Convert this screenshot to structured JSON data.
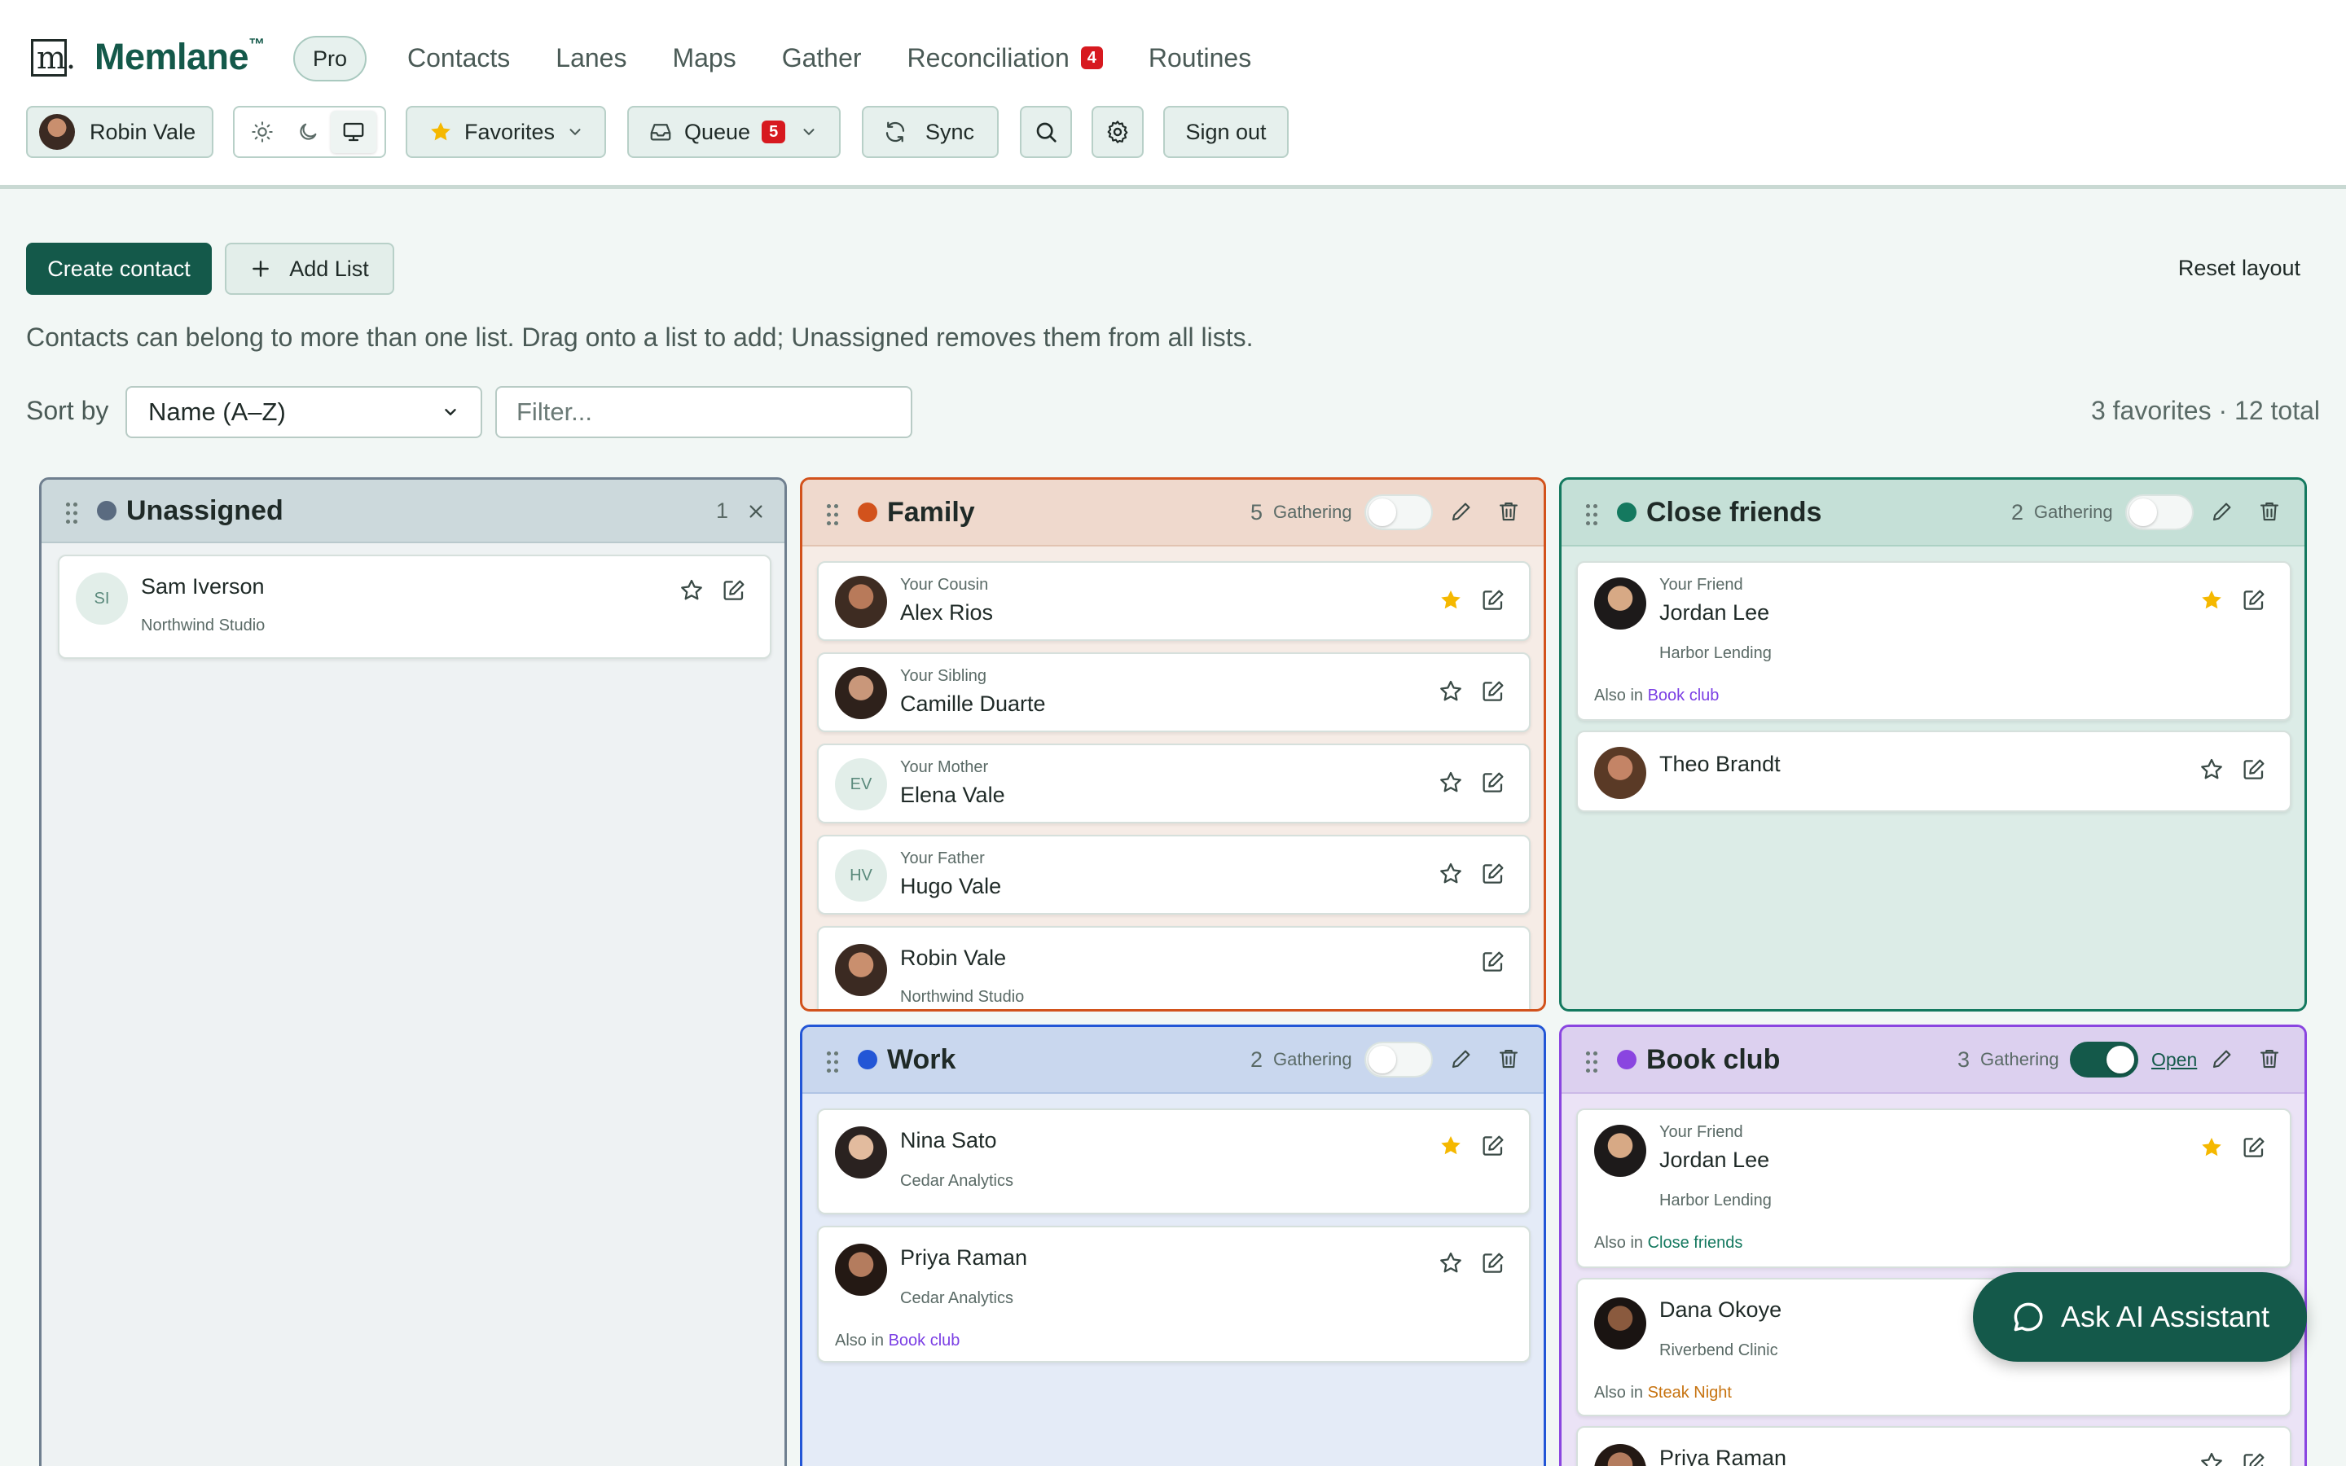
{
  "brand": {
    "logo_glyph": "m.",
    "name": "Memlane",
    "tm": "™",
    "plan_badge": "Pro"
  },
  "nav": [
    {
      "label": "Contacts"
    },
    {
      "label": "Lanes"
    },
    {
      "label": "Maps"
    },
    {
      "label": "Gather"
    },
    {
      "label": "Reconciliation",
      "badge": "4"
    },
    {
      "label": "Routines"
    }
  ],
  "toolbar": {
    "user_name": "Robin Vale",
    "theme_options": [
      "sun-icon",
      "moon-icon",
      "monitor-icon"
    ],
    "theme_selected": "monitor-icon",
    "favorites_label": "Favorites",
    "queue_label": "Queue",
    "queue_badge": "5",
    "sync_label": "Sync",
    "signout_label": "Sign out"
  },
  "actions": {
    "create_label": "Create contact",
    "add_list_label": "Add List",
    "reset_label": "Reset layout",
    "hint": "Contacts can belong to more than one list. Drag onto a list to add; Unassigned removes them from all lists."
  },
  "sort": {
    "label": "Sort by",
    "selected": "Name (A–Z)",
    "filter_placeholder": "Filter...",
    "totals": "3 favorites · 12 total"
  },
  "lanes": {
    "unassigned": {
      "title": "Unassigned",
      "count": "1",
      "color": "#5a6b80",
      "cards": [
        {
          "initials": "SI",
          "name": "Sam Iverson",
          "org": "Northwind Studio",
          "favorite": false
        }
      ]
    },
    "family": {
      "title": "Family",
      "count": "5",
      "gathering_label": "Gathering",
      "gathering_on": false,
      "color": "#d2521c",
      "cards": [
        {
          "rel": "Your Cousin",
          "name": "Alex Rios",
          "favorite": true
        },
        {
          "rel": "Your Sibling",
          "name": "Camille Duarte",
          "favorite": false
        },
        {
          "rel": "Your Mother",
          "name": "Elena Vale",
          "initials": "EV",
          "favorite": false
        },
        {
          "rel": "Your Father",
          "name": "Hugo Vale",
          "initials": "HV",
          "favorite": false
        },
        {
          "name": "Robin Vale",
          "org": "Northwind Studio"
        }
      ]
    },
    "close_friends": {
      "title": "Close friends",
      "count": "2",
      "gathering_label": "Gathering",
      "gathering_on": false,
      "color": "#14795f",
      "cards": [
        {
          "rel": "Your Friend",
          "name": "Jordan Lee",
          "org": "Harbor Lending",
          "also_prefix": "Also in",
          "also_list": "Book club",
          "favorite": true
        },
        {
          "name": "Theo Brandt",
          "favorite": false
        }
      ]
    },
    "work": {
      "title": "Work",
      "count": "2",
      "gathering_label": "Gathering",
      "gathering_on": false,
      "color": "#2356d6",
      "cards": [
        {
          "name": "Nina Sato",
          "org": "Cedar Analytics",
          "favorite": true
        },
        {
          "name": "Priya Raman",
          "org": "Cedar Analytics",
          "also_prefix": "Also in",
          "also_list": "Book club",
          "favorite": false
        }
      ]
    },
    "book_club": {
      "title": "Book club",
      "count": "3",
      "gathering_label": "Gathering",
      "gathering_on": true,
      "open_label": "Open",
      "color": "#8a45e0",
      "cards": [
        {
          "rel": "Your Friend",
          "name": "Jordan Lee",
          "org": "Harbor Lending",
          "also_prefix": "Also in",
          "also_list": "Close friends",
          "favorite": true
        },
        {
          "name": "Dana Okoye",
          "org": "Riverbend Clinic",
          "also_prefix": "Also in",
          "also_list": "Steak Night"
        },
        {
          "name": "Priya Raman",
          "favorite": false
        }
      ]
    }
  },
  "assistant": {
    "label": "Ask AI Assistant"
  },
  "colors": {
    "accent": "#14594a",
    "badge": "#d7191f",
    "favorite": "#f5b800"
  }
}
